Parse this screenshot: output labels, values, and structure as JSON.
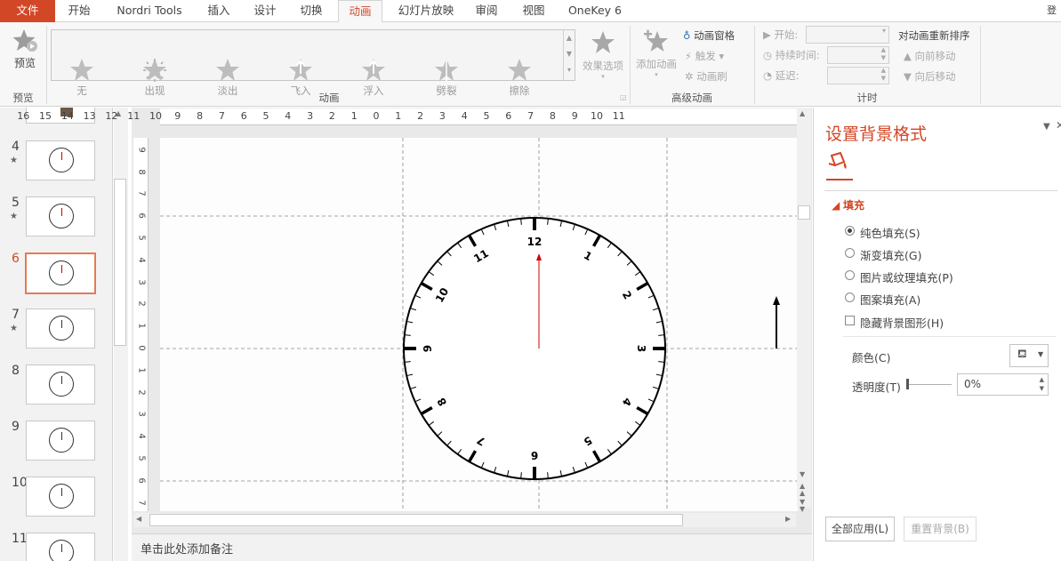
{
  "tabs": [
    "文件",
    "开始",
    "Nordri Tools",
    "插入",
    "设计",
    "切换",
    "动画",
    "幻灯片放映",
    "审阅",
    "视图",
    "OneKey 6"
  ],
  "active_tab": "动画",
  "user_initial": "登",
  "ribbon": {
    "preview": {
      "label": "预览",
      "group": "预览"
    },
    "gallery": {
      "items": [
        "无",
        "出现",
        "淡出",
        "飞入",
        "浮入",
        "劈裂",
        "擦除"
      ],
      "group": "动画"
    },
    "effect_options": "效果选项",
    "advanced": {
      "add_animation": "添加动画",
      "animation_pane": "动画窗格",
      "trigger": "触发",
      "painter": "动画刷",
      "group": "高级动画"
    },
    "timing": {
      "start": "开始:",
      "duration": "持续时间:",
      "delay": "延迟:",
      "reorder": "对动画重新排序",
      "move_earlier": "向前移动",
      "move_later": "向后移动",
      "group": "计时"
    }
  },
  "slides": [
    {
      "num": "4",
      "star": "★"
    },
    {
      "num": "5",
      "star": "★"
    },
    {
      "num": "6",
      "star": ""
    },
    {
      "num": "7",
      "star": "★"
    },
    {
      "num": "8",
      "star": ""
    },
    {
      "num": "9",
      "star": ""
    },
    {
      "num": "10",
      "star": ""
    },
    {
      "num": "11",
      "star": ""
    }
  ],
  "selected_slide": "6",
  "ruler_top": [
    "16",
    "15",
    "14",
    "13",
    "12",
    "11",
    "10",
    "9",
    "8",
    "7",
    "6",
    "5",
    "4",
    "3",
    "2",
    "1",
    "0",
    "1",
    "2",
    "3",
    "4",
    "5",
    "6",
    "7",
    "8",
    "9",
    "10",
    "11"
  ],
  "ruler_left": [
    "9",
    "8",
    "7",
    "6",
    "5",
    "4",
    "3",
    "2",
    "1",
    "0",
    "1",
    "2",
    "3",
    "4",
    "5",
    "6",
    "7"
  ],
  "clock_numbers": [
    "12",
    "1",
    "2",
    "3",
    "4",
    "5",
    "6",
    "7",
    "8",
    "9",
    "10",
    "11"
  ],
  "notes_placeholder": "单击此处添加备注",
  "panel": {
    "title": "设置背景格式",
    "section": "填充",
    "options": [
      "纯色填充(S)",
      "渐变填充(G)",
      "图片或纹理填充(P)",
      "图案填充(A)"
    ],
    "selected_option": "纯色填充(S)",
    "hide_bg": "隐藏背景图形(H)",
    "color_label": "颜色(C)",
    "transparency_label": "透明度(T)",
    "transparency_value": "0%",
    "apply_all": "全部应用(L)",
    "reset_bg": "重置背景(B)"
  },
  "colors": {
    "accent": "#d24726",
    "clock_hand": "#d00000"
  }
}
